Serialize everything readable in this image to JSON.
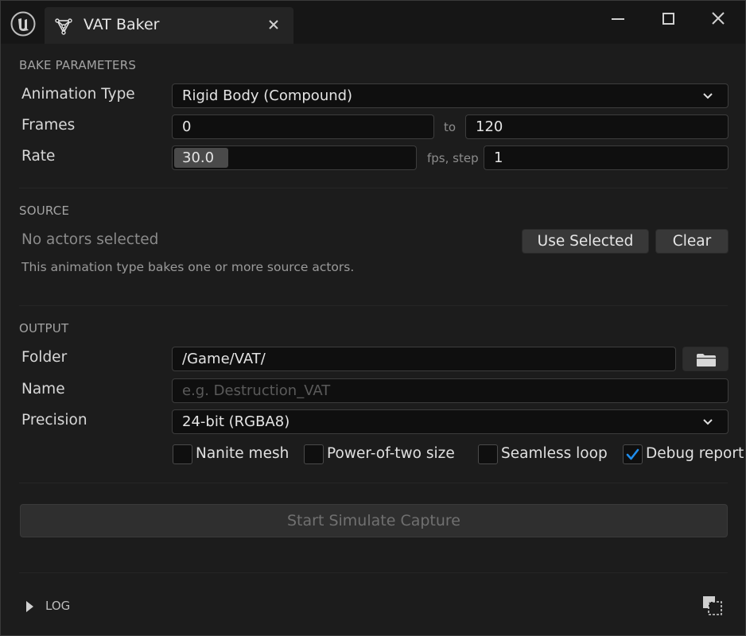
{
  "window": {
    "tab_title": "VAT Baker",
    "icons": [
      "unreal-engine-logo",
      "vat-tab-icon",
      "close-icon",
      "minimize-icon",
      "maximize-icon",
      "window-close-icon"
    ]
  },
  "bake_parameters": {
    "section_title": "BAKE PARAMETERS",
    "animation_type_label": "Animation Type",
    "animation_type_value": "Rigid Body (Compound)",
    "frames_label": "Frames",
    "frames_start": "0",
    "frames_to_label": "to",
    "frames_end": "120",
    "rate_label": "Rate",
    "rate_value": "30.0",
    "fps_step_label": "fps, step",
    "step_value": "1"
  },
  "source": {
    "section_title": "SOURCE",
    "status_text": "No actors selected",
    "use_selected_label": "Use Selected",
    "clear_label": "Clear",
    "hint_text": "This animation type bakes one or more source actors."
  },
  "output": {
    "section_title": "OUTPUT",
    "folder_label": "Folder",
    "folder_value": "/Game/VAT/",
    "name_label": "Name",
    "name_placeholder": "e.g. Destruction_VAT",
    "precision_label": "Precision",
    "precision_value": "24-bit (RGBA8)",
    "checkboxes": [
      {
        "label": "Nanite mesh",
        "checked": false
      },
      {
        "label": "Power-of-two size",
        "checked": false
      },
      {
        "label": "Seamless loop",
        "checked": false
      },
      {
        "label": "Debug report",
        "checked": true
      }
    ]
  },
  "actions": {
    "start_label": "Start Simulate Capture"
  },
  "log": {
    "label": "LOG"
  },
  "colors": {
    "accent": "#1f8ceb",
    "background": "#1c1c1c",
    "field": "#0f0f0f"
  }
}
